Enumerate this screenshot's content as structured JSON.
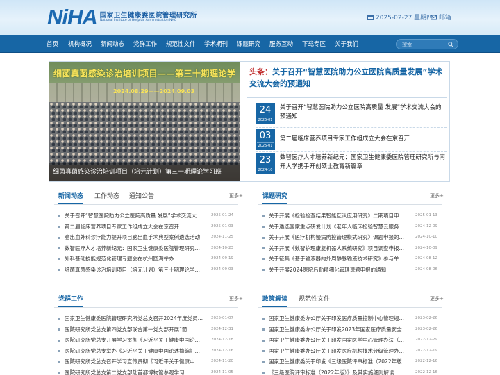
{
  "header": {
    "logo_mark": "NiHA",
    "logo_cn": "国家卫生健康委医院管理研究所",
    "logo_en": "National Institute of Hospital Administration,NHC",
    "date": "2025-02-27 星期四",
    "mail_label": "邮箱"
  },
  "nav": {
    "items": [
      "首页",
      "机构概况",
      "新闻动态",
      "党群工作",
      "规范性文件",
      "学术期刊",
      "课题研究",
      "服务互动",
      "下载专区",
      "关于我们"
    ],
    "search_placeholder": "搜索"
  },
  "banner": {
    "photo_title": "细菌真菌感染诊治培训项目——第三十期理论学习班",
    "photo_date": "2024.08.29——2024.09.03",
    "photo_caption": "细菌真菌感染诊治培训项目（培元计划）第三十期理论学习班",
    "headline_tag": "头条：",
    "headline_text": "关于召开“智慧医院助力公立医院高质量发展”学术交流大会的预通知",
    "entries": [
      {
        "day": "24",
        "month": "2025-01",
        "text": "关于召开“智慧医院助力公立医院高质量 发展”学术交流大会的预通知"
      },
      {
        "day": "03",
        "month": "2025-01",
        "text": "第二届临床营养项目专家工作组成立大会在京召开"
      },
      {
        "day": "23",
        "month": "2024-10",
        "text": "数智医疗人才培养新纪元：国家卫生健康委医院管理研究所与南开大学携手开创硕士教育新篇章"
      }
    ]
  },
  "news_panel": {
    "tabs": [
      "新闻动态",
      "工作动态",
      "通知公告"
    ],
    "more": "更多+",
    "items": [
      {
        "title": "关于召开“智慧医院助力公立医院高质量 发展”学术交流大会的预通知",
        "date": "2025-01-24"
      },
      {
        "title": "第二届临床营养项目专家工作组成立大会在京召开",
        "date": "2025-01-03"
      },
      {
        "title": "脑出血外科诊疗能力提升项目脑出血手术典型案例遴选活动",
        "date": "2024-11-25"
      },
      {
        "title": "数智医疗人才培养新纪元：国家卫生健康委医院管理研究所与南开大学携手",
        "date": "2024-10-23"
      },
      {
        "title": "外科基础技能规范化管理专题会在杭州圆满举办",
        "date": "2024-09-19"
      },
      {
        "title": "细菌真菌感染诊治培训项目（培元计划）第三十期理论学习班",
        "date": "2024-09-03"
      }
    ]
  },
  "research_panel": {
    "tabs": [
      "课题研究"
    ],
    "more": "更多+",
    "items": [
      {
        "title": "关于开展《检验检查结果智能互认应用研究》二期项目申报的通知",
        "date": "2025-01-13"
      },
      {
        "title": "关于遴选国家重点研发计划《老年人临床检验智慧云服务》课题参与单位",
        "date": "2024-12-09"
      },
      {
        "title": "关于开展《医疗机构慢病防控管理模式研究》课题申报的通知",
        "date": "2024-10-10"
      },
      {
        "title": "关于开展《数智护理康复机器人系统研究》项目调查申报的通知",
        "date": "2024-10-09"
      },
      {
        "title": "关于征集《基于输液器的外周静脉输液技术研究》参与单位的通知",
        "date": "2024-08-12"
      },
      {
        "title": "关于开展2024医院后勤精细化管理课题申报的通知",
        "date": "2024-08-06"
      }
    ]
  },
  "party_panel": {
    "tabs": [
      "党群工作"
    ],
    "more": "更多+",
    "items": [
      {
        "title": "国家卫生健康委医院管理研究所党总支召开2024年度党员大会",
        "date": "2025-01-07"
      },
      {
        "title": "医院研究所党总支第四党支部联合第一党支部开展“箭",
        "date": "2024-12-31"
      },
      {
        "title": "医院研究所党总支开展学习贯彻《习近平关于健康中国论述摘编》专题学习",
        "date": "2024-12-18"
      },
      {
        "title": "医院研究所党总支举办《习近平关于健康中国论述摘编》专题学习",
        "date": "2024-12-16"
      },
      {
        "title": "医院研究所党总支召开学习宣传贯彻《习近平关于健康中国论述摘编》",
        "date": "2024-11-20"
      },
      {
        "title": "医院研究所党总支第二党支部赴首都博物馆参观学习",
        "date": "2024-11-05"
      }
    ]
  },
  "policy_panel": {
    "tabs": [
      "政策解读",
      "规范性文件"
    ],
    "more": "更多+",
    "items": [
      {
        "title": "国家卫生健康委办公厅关于印发医疗质量控制中心管理规定的通知",
        "date": "2023-02-26"
      },
      {
        "title": "国家卫生健康委办公厅关于印发2023年国家医疗质量安全改进目标的通知",
        "date": "2023-02-26"
      },
      {
        "title": "国家卫生健康委办公厅关于印发国家医学中心管理办法（试行）",
        "date": "2022-12-29"
      },
      {
        "title": "国家卫生健康委办公厅关于印发医疗机构技术分级管理办法的通知",
        "date": "2022-12-19"
      },
      {
        "title": "国家卫生健康委关于印发《三级医院评审标准（2022年版）》",
        "date": "2022-12-16"
      },
      {
        "title": "《三级医院评审标准（2022年版）》及其实施细则解读",
        "date": "2022-12-16"
      }
    ]
  },
  "colors": {
    "primary": "#1766a5",
    "headline_tag": "#c23030",
    "badge": "#1766a5"
  }
}
